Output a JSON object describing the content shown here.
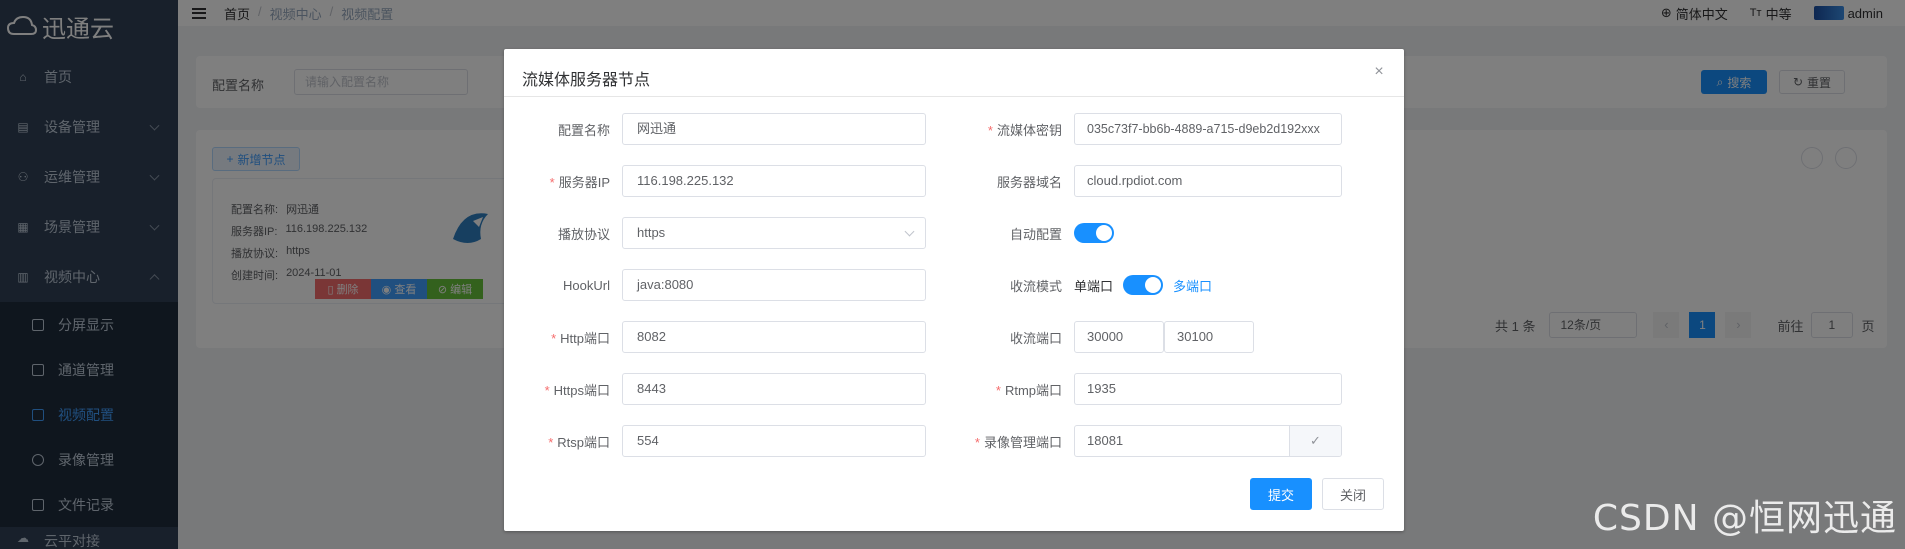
{
  "app": {
    "logo_text": "迅通云"
  },
  "sidebar": {
    "items": [
      {
        "label": "首页"
      },
      {
        "label": "设备管理"
      },
      {
        "label": "运维管理"
      },
      {
        "label": "场景管理"
      },
      {
        "label": "视频中心"
      }
    ],
    "sub_items": [
      {
        "label": "分屏显示"
      },
      {
        "label": "通道管理"
      },
      {
        "label": "视频配置"
      },
      {
        "label": "录像管理"
      },
      {
        "label": "文件记录"
      }
    ],
    "partial_item": {
      "label": "云平对接"
    }
  },
  "header": {
    "breadcrumb": [
      "首页",
      "视频中心",
      "视频配置"
    ],
    "language": "简体中文",
    "font_size": "中等",
    "user": "admin"
  },
  "search": {
    "label": "配置名称",
    "placeholder": "请输入配置名称",
    "search_button": "搜索",
    "reset_button": "重置"
  },
  "list": {
    "add_button": "新增节点",
    "card": {
      "fields": [
        {
          "label": "配置名称:",
          "value": "网迅通"
        },
        {
          "label": "服务器IP:",
          "value": "116.198.225.132"
        },
        {
          "label": "播放协议:",
          "value": "https"
        },
        {
          "label": "创建时间:",
          "value": "2024-11-01"
        }
      ],
      "delete_button": "删除",
      "view_button": "查看",
      "edit_button": "编辑"
    },
    "pagination": {
      "total": "共 1 条",
      "page_size": "12条/页",
      "current_page": "1",
      "goto_label": "前往",
      "goto_value": "1",
      "goto_suffix": "页"
    }
  },
  "dialog": {
    "title": "流媒体服务器节点",
    "left_fields": [
      {
        "label": "配置名称",
        "required": false,
        "value": "网迅通"
      },
      {
        "label": "服务器IP",
        "required": true,
        "value": "116.198.225.132"
      },
      {
        "label": "播放协议",
        "required": false,
        "value": "https"
      },
      {
        "label": "HookUrl",
        "required": false,
        "value": "java:8080"
      },
      {
        "label": "Http端口",
        "required": true,
        "value": "8082"
      },
      {
        "label": "Https端口",
        "required": true,
        "value": "8443"
      },
      {
        "label": "Rtsp端口",
        "required": true,
        "value": "554"
      }
    ],
    "right_fields": {
      "secret": {
        "label": "流媒体密钥",
        "required": true,
        "value": "035c73f7-bb6b-4889-a715-d9eb2d192xxx"
      },
      "domain": {
        "label": "服务器域名",
        "required": false,
        "value": "cloud.rpdiot.com"
      },
      "auto_config": {
        "label": "自动配置",
        "on": true
      },
      "recv_mode": {
        "label": "收流模式",
        "left_text": "单端口",
        "right_text": "多端口",
        "on": true
      },
      "recv_port": {
        "label": "收流端口",
        "start": "30000",
        "end": "30100"
      },
      "rtmp": {
        "label": "Rtmp端口",
        "required": true,
        "value": "1935"
      },
      "record": {
        "label": "录像管理端口",
        "required": true,
        "value": "18081"
      }
    },
    "submit_button": "提交",
    "close_button": "关闭"
  },
  "watermark": "CSDN @恒网迅通",
  "colors": {
    "primary": "#1890ff",
    "sidebar_bg": "#304156",
    "submenu_bg": "#1f2d3d",
    "required": "#f56c6c",
    "delete": "#f56c6c",
    "view": "#409eff",
    "edit": "#67c23a"
  },
  "icons": {
    "close": "×",
    "check": "✓"
  }
}
